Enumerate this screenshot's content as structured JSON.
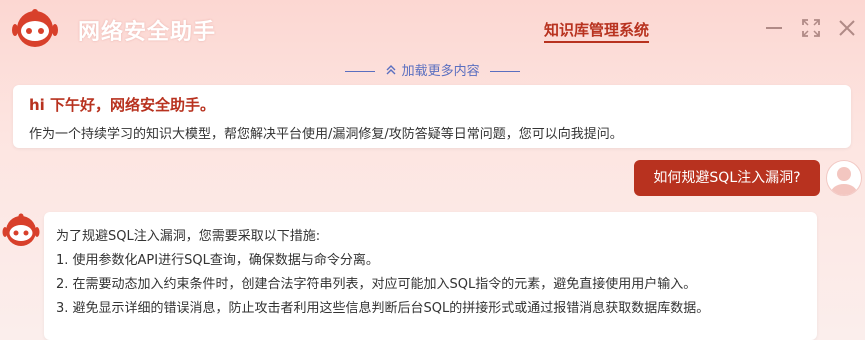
{
  "app": {
    "title": "网络安全助手",
    "kb_link": "知识库管理系统",
    "controls": [
      "minimize-icon",
      "restore-icon",
      "close-icon"
    ]
  },
  "load_more": {
    "label": "加载更多内容",
    "icon": "double-chevron-up-icon"
  },
  "welcome": {
    "title": "hi 下午好，网络安全助手。",
    "body": "作为一个持续学习的知识大模型，帮您解决平台使用/漏洞修复/攻防答疑等日常问题，您可以向我提问。"
  },
  "user_message": {
    "text": "如何规避SQL注入漏洞?"
  },
  "bot_answer": {
    "lines": [
      "为了规避SQL注入漏洞，您需要采取以下措施:",
      "1. 使用参数化API进行SQL查询，确保数据与命令分离。",
      "2. 在需要动态加入约束条件时，创建合法字符串列表，对应可能加入SQL指令的元素，避免直接使用用户输入。",
      "3. 避免显示详细的错误消息，防止攻击者利用这些信息判断后台SQL的拼接形式或通过报错消息获取数据库数据。"
    ]
  },
  "colors": {
    "accent": "#b8321f",
    "link": "#5a6fc0",
    "text": "#333333"
  }
}
